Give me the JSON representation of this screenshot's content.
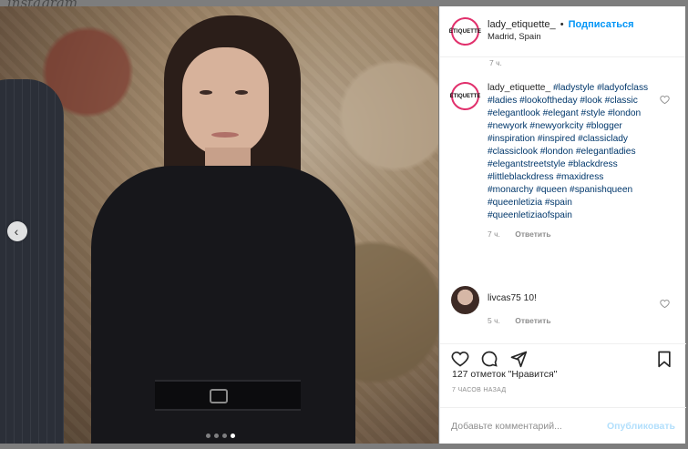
{
  "ghost_title": "instagram",
  "photo": {
    "slide_count": 4,
    "active_slide": 4
  },
  "post": {
    "username": "lady_etiquette_",
    "separator": "•",
    "follow_label": "Подписаться",
    "location": "Madrid, Spain",
    "avatar_text": "ÉTIQUETTE"
  },
  "comments": {
    "top_timestamp": "7 ч.",
    "caption": {
      "username": "lady_etiquette_",
      "hashtags": "#ladystyle #ladyofclass #ladies #lookoftheday #look #classic #elegantlook #elegant #style #london #newyork #newyorkcity #blogger #inspiration #inspired #classiclady #classiclook #london #elegantladies #elegantstreetstyle #blackdress #littleblackdress #maxidress #monarchy #queen #spanishqueen #queenletizia #spain #queenletiziaofspain",
      "time": "7 ч.",
      "reply_label": "Ответить"
    },
    "reply": {
      "username": "livcas75",
      "text": "10!",
      "time": "5 ч.",
      "reply_label": "Ответить"
    }
  },
  "likes_text": "127 отметок \"Нравится\"",
  "posted_ago": "7 ЧАСОВ НАЗАД",
  "comment_placeholder": "Добавьте комментарий...",
  "publish_label": "Опубликовать",
  "colors": {
    "follow": "#0095f6",
    "hashtag": "#00376b",
    "muted": "#8e8e8e",
    "ring": "#e1306c"
  }
}
